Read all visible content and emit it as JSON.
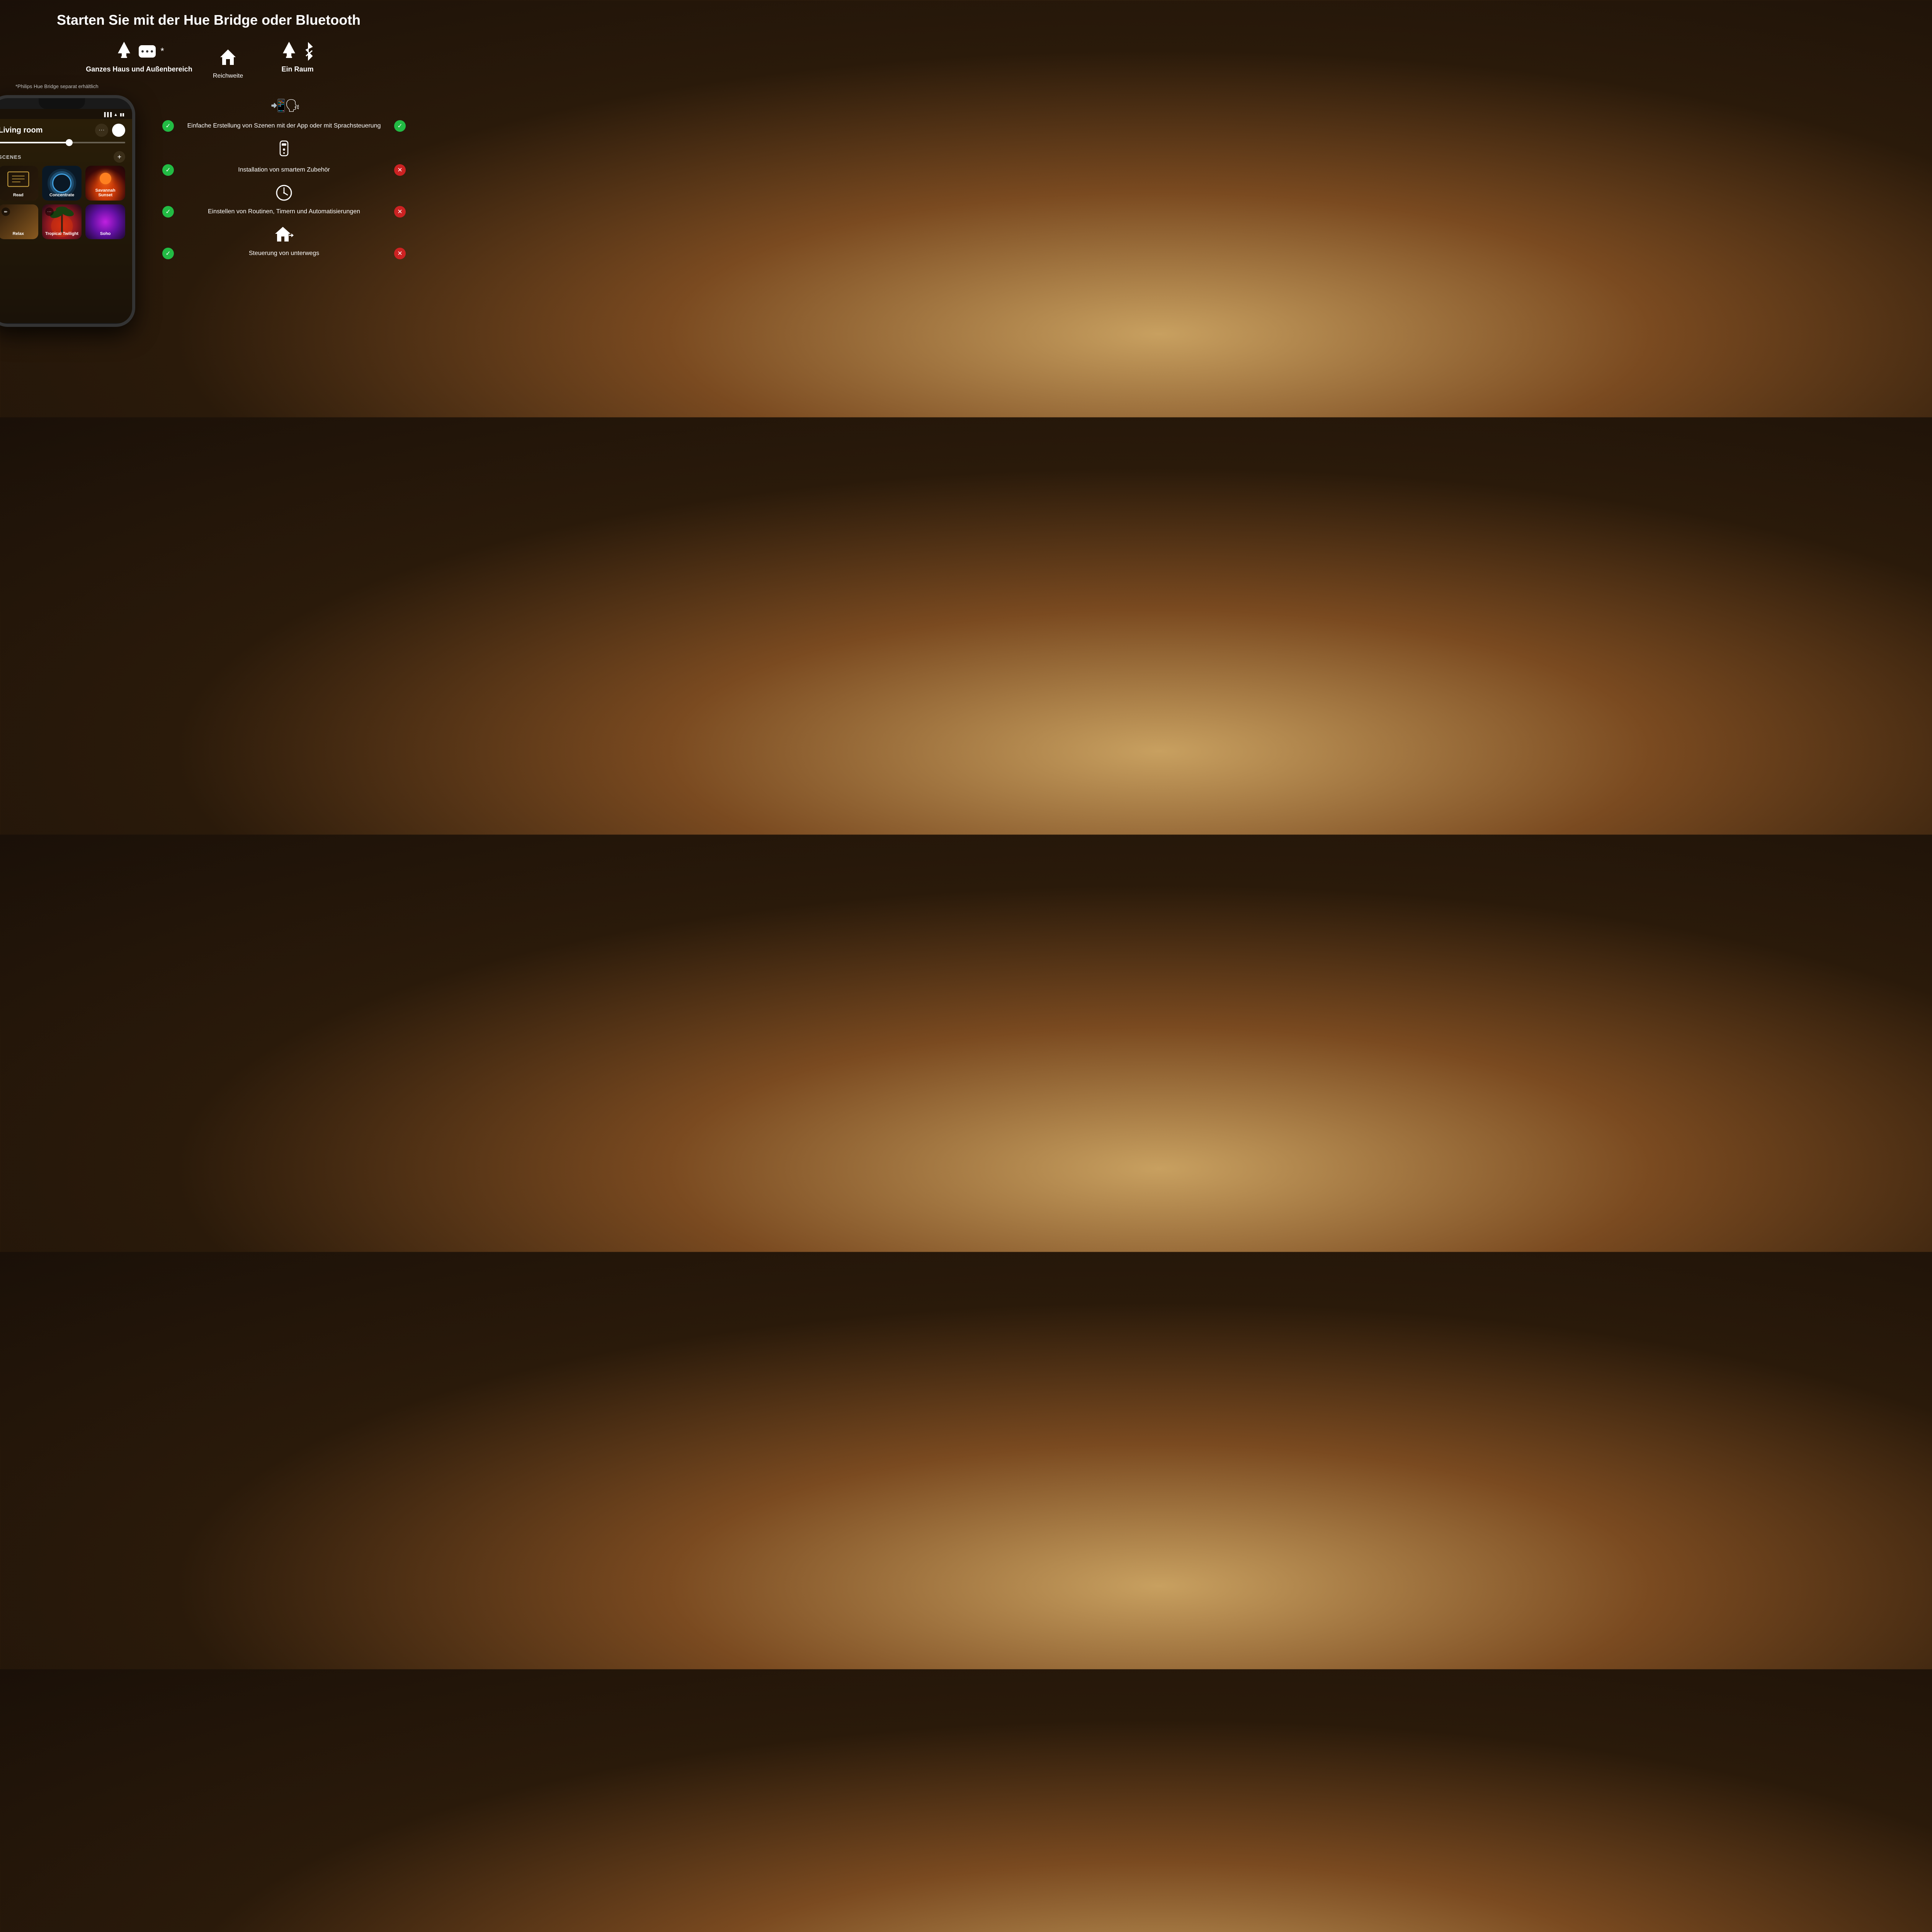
{
  "title": "Starten Sie mit der Hue Bridge oder Bluetooth",
  "bridge_section": {
    "label": "Ganzes Haus und Außenbereich",
    "asterisk": "*"
  },
  "range_section": {
    "label": "Reichweite"
  },
  "bluetooth_section": {
    "label": "Ein Raum"
  },
  "asterisk_note": "*Philips Hue Bridge separat erhältlich",
  "features": [
    {
      "id": "voice",
      "text": "Einfache Erstellung von Szenen mit der App oder mit Sprachsteuerung",
      "bridge": true,
      "bluetooth": true
    },
    {
      "id": "accessories",
      "text": "Installation von smartem Zubehör",
      "bridge": true,
      "bluetooth": false
    },
    {
      "id": "routines",
      "text": "Einstellen von Routinen, Timern und Automatisierungen",
      "bridge": true,
      "bluetooth": false
    },
    {
      "id": "remote",
      "text": "Steuerung von unterwegs",
      "bridge": true,
      "bluetooth": false
    }
  ],
  "phone": {
    "room": "Living room",
    "scenes_label": "SCENES",
    "scenes": [
      {
        "name": "Read",
        "type": "read"
      },
      {
        "name": "Concentrate",
        "type": "concentrate"
      },
      {
        "name": "Savannah Sunset",
        "type": "savannah"
      },
      {
        "name": "Relax",
        "type": "relax"
      },
      {
        "name": "Tropical Twilight",
        "type": "tropical"
      },
      {
        "name": "Soho",
        "type": "soho"
      }
    ]
  }
}
